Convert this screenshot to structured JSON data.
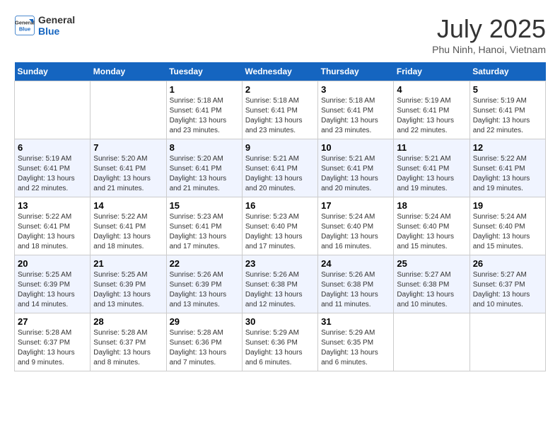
{
  "header": {
    "logo_line1": "General",
    "logo_line2": "Blue",
    "month": "July 2025",
    "location": "Phu Ninh, Hanoi, Vietnam"
  },
  "days_of_week": [
    "Sunday",
    "Monday",
    "Tuesday",
    "Wednesday",
    "Thursday",
    "Friday",
    "Saturday"
  ],
  "weeks": [
    [
      {
        "day": "",
        "info": ""
      },
      {
        "day": "",
        "info": ""
      },
      {
        "day": "1",
        "info": "Sunrise: 5:18 AM\nSunset: 6:41 PM\nDaylight: 13 hours and 23 minutes."
      },
      {
        "day": "2",
        "info": "Sunrise: 5:18 AM\nSunset: 6:41 PM\nDaylight: 13 hours and 23 minutes."
      },
      {
        "day": "3",
        "info": "Sunrise: 5:18 AM\nSunset: 6:41 PM\nDaylight: 13 hours and 23 minutes."
      },
      {
        "day": "4",
        "info": "Sunrise: 5:19 AM\nSunset: 6:41 PM\nDaylight: 13 hours and 22 minutes."
      },
      {
        "day": "5",
        "info": "Sunrise: 5:19 AM\nSunset: 6:41 PM\nDaylight: 13 hours and 22 minutes."
      }
    ],
    [
      {
        "day": "6",
        "info": "Sunrise: 5:19 AM\nSunset: 6:41 PM\nDaylight: 13 hours and 22 minutes."
      },
      {
        "day": "7",
        "info": "Sunrise: 5:20 AM\nSunset: 6:41 PM\nDaylight: 13 hours and 21 minutes."
      },
      {
        "day": "8",
        "info": "Sunrise: 5:20 AM\nSunset: 6:41 PM\nDaylight: 13 hours and 21 minutes."
      },
      {
        "day": "9",
        "info": "Sunrise: 5:21 AM\nSunset: 6:41 PM\nDaylight: 13 hours and 20 minutes."
      },
      {
        "day": "10",
        "info": "Sunrise: 5:21 AM\nSunset: 6:41 PM\nDaylight: 13 hours and 20 minutes."
      },
      {
        "day": "11",
        "info": "Sunrise: 5:21 AM\nSunset: 6:41 PM\nDaylight: 13 hours and 19 minutes."
      },
      {
        "day": "12",
        "info": "Sunrise: 5:22 AM\nSunset: 6:41 PM\nDaylight: 13 hours and 19 minutes."
      }
    ],
    [
      {
        "day": "13",
        "info": "Sunrise: 5:22 AM\nSunset: 6:41 PM\nDaylight: 13 hours and 18 minutes."
      },
      {
        "day": "14",
        "info": "Sunrise: 5:22 AM\nSunset: 6:41 PM\nDaylight: 13 hours and 18 minutes."
      },
      {
        "day": "15",
        "info": "Sunrise: 5:23 AM\nSunset: 6:41 PM\nDaylight: 13 hours and 17 minutes."
      },
      {
        "day": "16",
        "info": "Sunrise: 5:23 AM\nSunset: 6:40 PM\nDaylight: 13 hours and 17 minutes."
      },
      {
        "day": "17",
        "info": "Sunrise: 5:24 AM\nSunset: 6:40 PM\nDaylight: 13 hours and 16 minutes."
      },
      {
        "day": "18",
        "info": "Sunrise: 5:24 AM\nSunset: 6:40 PM\nDaylight: 13 hours and 15 minutes."
      },
      {
        "day": "19",
        "info": "Sunrise: 5:24 AM\nSunset: 6:40 PM\nDaylight: 13 hours and 15 minutes."
      }
    ],
    [
      {
        "day": "20",
        "info": "Sunrise: 5:25 AM\nSunset: 6:39 PM\nDaylight: 13 hours and 14 minutes."
      },
      {
        "day": "21",
        "info": "Sunrise: 5:25 AM\nSunset: 6:39 PM\nDaylight: 13 hours and 13 minutes."
      },
      {
        "day": "22",
        "info": "Sunrise: 5:26 AM\nSunset: 6:39 PM\nDaylight: 13 hours and 13 minutes."
      },
      {
        "day": "23",
        "info": "Sunrise: 5:26 AM\nSunset: 6:38 PM\nDaylight: 13 hours and 12 minutes."
      },
      {
        "day": "24",
        "info": "Sunrise: 5:26 AM\nSunset: 6:38 PM\nDaylight: 13 hours and 11 minutes."
      },
      {
        "day": "25",
        "info": "Sunrise: 5:27 AM\nSunset: 6:38 PM\nDaylight: 13 hours and 10 minutes."
      },
      {
        "day": "26",
        "info": "Sunrise: 5:27 AM\nSunset: 6:37 PM\nDaylight: 13 hours and 10 minutes."
      }
    ],
    [
      {
        "day": "27",
        "info": "Sunrise: 5:28 AM\nSunset: 6:37 PM\nDaylight: 13 hours and 9 minutes."
      },
      {
        "day": "28",
        "info": "Sunrise: 5:28 AM\nSunset: 6:37 PM\nDaylight: 13 hours and 8 minutes."
      },
      {
        "day": "29",
        "info": "Sunrise: 5:28 AM\nSunset: 6:36 PM\nDaylight: 13 hours and 7 minutes."
      },
      {
        "day": "30",
        "info": "Sunrise: 5:29 AM\nSunset: 6:36 PM\nDaylight: 13 hours and 6 minutes."
      },
      {
        "day": "31",
        "info": "Sunrise: 5:29 AM\nSunset: 6:35 PM\nDaylight: 13 hours and 6 minutes."
      },
      {
        "day": "",
        "info": ""
      },
      {
        "day": "",
        "info": ""
      }
    ]
  ]
}
